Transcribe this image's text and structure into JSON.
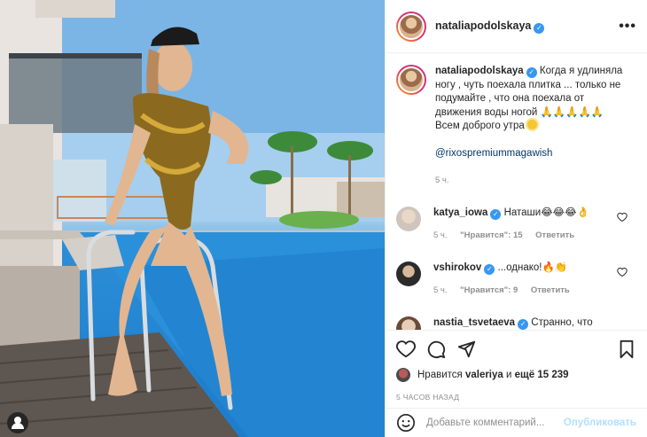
{
  "post": {
    "username": "nataliapodolskaya",
    "verified_icon": "verified-badge-icon",
    "more_icon": "more-options-icon"
  },
  "caption": {
    "username": "nataliapodolskaya",
    "text": "Когда я удлиняла ногу , чуть поехала плитка ... только не подумайте , что она поехала от движения воды ногой 🙏🙏🙏🙏🙏 Всем доброго утра",
    "tag": "@rixospremiummagawish",
    "time": "5 ч."
  },
  "comments": [
    {
      "username": "katya_iowa",
      "text": "Наташи😂😂😂👌",
      "time": "5 ч.",
      "likes": "\"Нравится\": 15",
      "reply": "Ответить"
    },
    {
      "username": "vshirokov",
      "text": "...однако!🔥👏",
      "time": "5 ч.",
      "likes": "\"Нравится\": 9",
      "reply": "Ответить"
    },
    {
      "username": "nastia_tsvetaeva",
      "text": "Странно, что"
    }
  ],
  "likes": {
    "prefix": "Нравится",
    "user": "valeriya",
    "and": "и",
    "more": "ещё 15 239"
  },
  "posted_ago": "5 ЧАСОВ НАЗАД",
  "add_comment": {
    "placeholder": "Добавьте комментарий...",
    "post_label": "Опубликовать"
  },
  "colors": {
    "accent": "#3897f0",
    "post_disabled": "#b2dffc",
    "muted": "#8e8e8e"
  }
}
